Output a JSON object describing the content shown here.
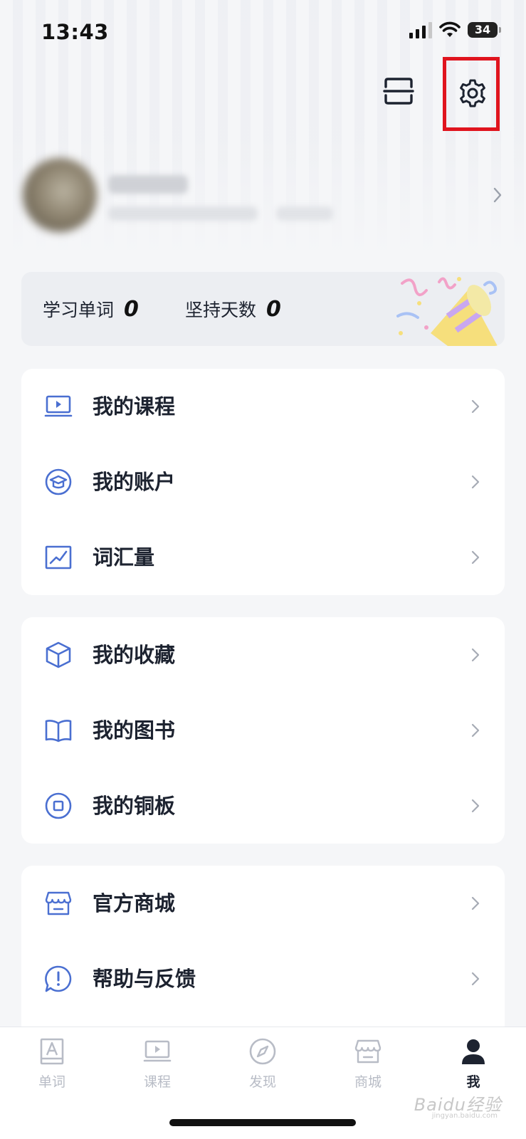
{
  "status_bar": {
    "time": "13:43",
    "battery": "34"
  },
  "header": {
    "scan_icon": "scan-icon",
    "settings_icon": "gear-icon"
  },
  "stats": {
    "words_label": "学习单词",
    "words_value": "0",
    "days_label": "坚持天数",
    "days_value": "0"
  },
  "menu_group_1": [
    {
      "label": "我的课程",
      "icon": "video-course-icon"
    },
    {
      "label": "我的账户",
      "icon": "graduation-cap-icon"
    },
    {
      "label": "词汇量",
      "icon": "trend-chart-icon"
    }
  ],
  "menu_group_2": [
    {
      "label": "我的收藏",
      "icon": "box-icon"
    },
    {
      "label": "我的图书",
      "icon": "open-book-icon"
    },
    {
      "label": "我的铜板",
      "icon": "coin-icon"
    }
  ],
  "menu_group_3": [
    {
      "label": "官方商城",
      "icon": "store-icon"
    },
    {
      "label": "帮助与反馈",
      "icon": "help-bubble-icon"
    }
  ],
  "tabs": [
    {
      "label": "单词",
      "icon": "word-card-icon",
      "active": false
    },
    {
      "label": "课程",
      "icon": "video-course-icon",
      "active": false
    },
    {
      "label": "发现",
      "icon": "compass-icon",
      "active": false
    },
    {
      "label": "商城",
      "icon": "store-icon",
      "active": false
    },
    {
      "label": "我",
      "icon": "person-icon",
      "active": true
    }
  ],
  "watermark": {
    "text": "Baidu经验",
    "sub": "jingyan.baidu.com"
  },
  "colors": {
    "accent_blue": "#4a6fd1",
    "highlight_red": "#e0141e",
    "inactive_tab": "#b8bcc6"
  }
}
